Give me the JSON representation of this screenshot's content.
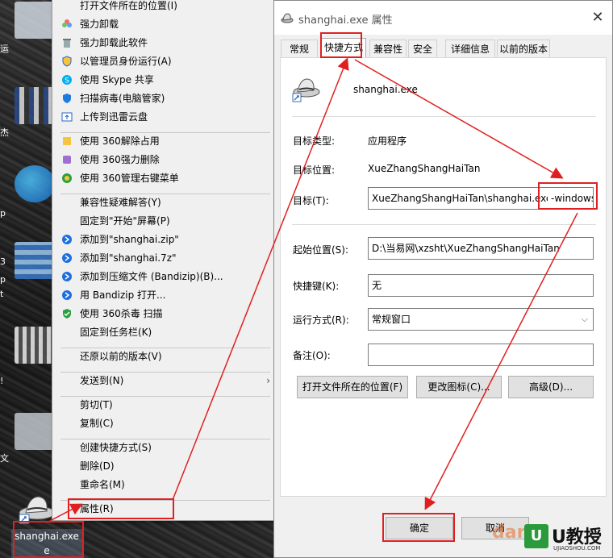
{
  "desktop": {
    "shortcut_label_line1": "shanghai.exe",
    "shortcut_label_line2": "e",
    "edge_text": [
      "运",
      "杰",
      "p",
      "3",
      "p",
      "t",
      "!",
      "文"
    ]
  },
  "context_menu": {
    "items": [
      {
        "label": "打开文件所在的位置(I)",
        "icon": "none"
      },
      {
        "label": "强力卸载",
        "icon": "flower-icon"
      },
      {
        "label": "强力卸载此软件",
        "icon": "trash-icon"
      },
      {
        "label": "以管理员身份运行(A)",
        "icon": "shield-icon"
      },
      {
        "label": "使用 Skype 共享",
        "icon": "skype-icon"
      },
      {
        "label": "扫描病毒(电脑管家)",
        "icon": "guard-icon"
      },
      {
        "label": "上传到迅雷云盘",
        "icon": "cloud-icon"
      },
      {
        "label": "使用 360解除占用",
        "icon": "unlock-icon"
      },
      {
        "label": "使用 360强力删除",
        "icon": "delete-icon"
      },
      {
        "label": "使用 360管理右键菜单",
        "icon": "manage-icon"
      },
      {
        "label": "兼容性疑难解答(Y)",
        "icon": "none"
      },
      {
        "label": "固定到\"开始\"屏幕(P)",
        "icon": "none"
      },
      {
        "label": "添加到\"shanghai.zip\"",
        "icon": "bandizip-icon"
      },
      {
        "label": "添加到\"shanghai.7z\"",
        "icon": "bandizip-icon"
      },
      {
        "label": "添加到压缩文件 (Bandizip)(B)...",
        "icon": "bandizip-icon"
      },
      {
        "label": "用 Bandizip 打开...",
        "icon": "bandizip-icon"
      },
      {
        "label": "使用 360杀毒 扫描",
        "icon": "antivirus-icon"
      },
      {
        "label": "固定到任务栏(K)",
        "icon": "none"
      },
      {
        "label": "还原以前的版本(V)",
        "icon": "none"
      },
      {
        "label": "发送到(N)",
        "icon": "none"
      },
      {
        "label": "剪切(T)",
        "icon": "none"
      },
      {
        "label": "复制(C)",
        "icon": "none"
      },
      {
        "label": "创建快捷方式(S)",
        "icon": "none"
      },
      {
        "label": "删除(D)",
        "icon": "none"
      },
      {
        "label": "重命名(M)",
        "icon": "none"
      },
      {
        "label": "属性(R)",
        "icon": "none"
      }
    ]
  },
  "dialog": {
    "title": "shanghai.exe 属性",
    "tabs": [
      "常规",
      "快捷方式",
      "兼容性",
      "安全",
      "详细信息",
      "以前的版本"
    ],
    "active_tab": "快捷方式",
    "file_name": "shanghai.exe",
    "target_type_label": "目标类型:",
    "target_type_value": "应用程序",
    "target_location_label": "目标位置:",
    "target_location_value": "XueZhangShangHaiTan",
    "target_label": "目标(T):",
    "target_value": "XueZhangShangHaiTan\\shanghai.exe",
    "target_suffix": "-windows",
    "start_in_label": "起始位置(S):",
    "start_in_value": "D:\\当易网\\xzsht\\XueZhangShangHaiTan",
    "hotkey_label": "快捷键(K):",
    "hotkey_value": "无",
    "run_label": "运行方式(R):",
    "run_value": "常规窗口",
    "comment_label": "备注(O):",
    "comment_value": "",
    "open_location_button": "打开文件所在的位置(F)",
    "change_icon_button": "更改图标(C)...",
    "advanced_button": "高级(D)...",
    "ok_button": "确定",
    "cancel_button": "取消"
  },
  "watermark": {
    "left": "dan",
    "right": "U教授",
    "small": "UJIAOSHOU.COM"
  },
  "colors": {
    "annotation_red": "#e02020",
    "window_bg": "#f0f0f0"
  }
}
